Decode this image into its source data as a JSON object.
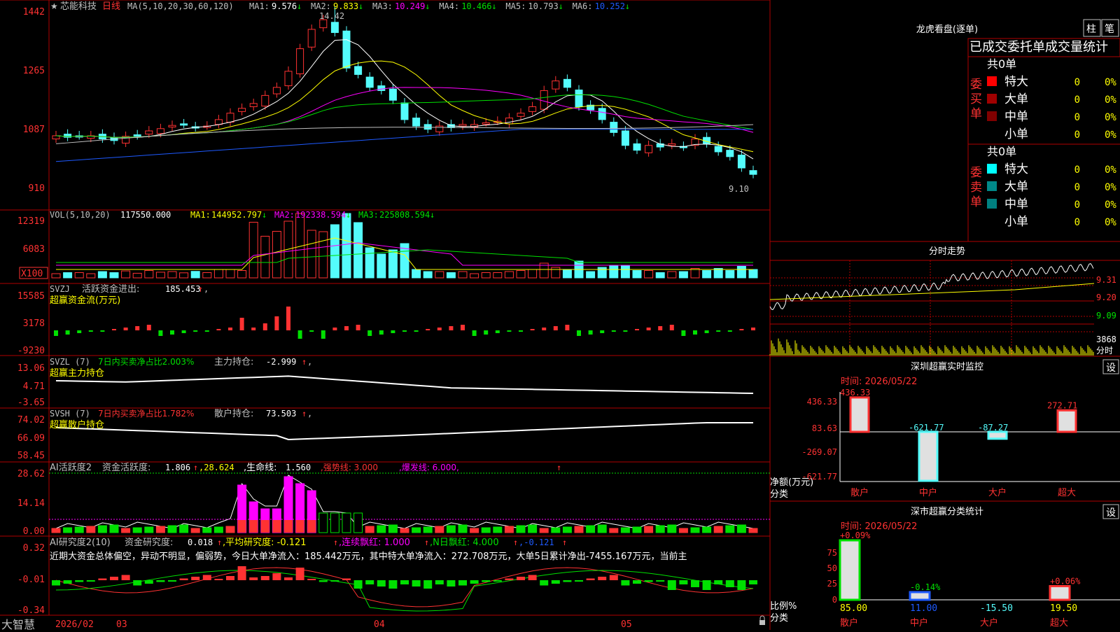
{
  "colors": {
    "up": "#ff3232",
    "down": "#54fcfc",
    "ma1": "#ffffff",
    "ma2": "#ffff00",
    "ma3": "#ff00ff",
    "ma4": "#00e000",
    "ma5": "#c0c0c0",
    "ma6": "#1e5aff",
    "green": "#00e000",
    "grid": "#b00000"
  },
  "brand": "大智慧",
  "stock": {
    "star": "★",
    "name": "芯能科技",
    "period": "日线",
    "ma_params": "MA(5,10,20,30,60,120)",
    "ma": [
      {
        "label": "MA1:",
        "value": "9.576",
        "arrow": "↓"
      },
      {
        "label": "MA2:",
        "value": "9.833",
        "arrow": "↓"
      },
      {
        "label": "MA3:",
        "value": "10.249",
        "arrow": "↓"
      },
      {
        "label": "MA4:",
        "value": "10.466",
        "arrow": "↓"
      },
      {
        "label": "MA5:",
        "value": "10.793",
        "arrow": "↓"
      },
      {
        "label": "MA6:",
        "value": "10.252",
        "arrow": "↓"
      }
    ],
    "high_label": "14.42",
    "low_label": "9.10",
    "y_ticks": [
      "1442",
      "1265",
      "1087",
      "910"
    ]
  },
  "vol": {
    "title": "VOL(5,10,20)",
    "value": "117550.000",
    "ma": [
      {
        "label": "MA1:",
        "value": "144952.797",
        "arrow": "↓"
      },
      {
        "label": "MA2:",
        "value": "192338.594",
        "arrow": "↓"
      },
      {
        "label": "MA3:",
        "value": "225808.594",
        "arrow": "↓"
      }
    ],
    "y_ticks": [
      "12319",
      "6083"
    ],
    "unit": "X100"
  },
  "svzj": {
    "title": "SVZJ",
    "label": "活跃资金进出:",
    "value": "185.453",
    "arrow": "↑",
    "comma": ",",
    "sub": "超赢资金流(万元)",
    "y_ticks": [
      "15585",
      "3178",
      "-9230"
    ]
  },
  "svzl": {
    "title": "SVZL (7)",
    "ratio": "7日内买卖净占比2.003%",
    "label": "主力持仓:",
    "value": "-2.999",
    "arrow": "↑",
    "comma": ",",
    "sub": "超赢主力持仓",
    "y_ticks": [
      "13.06",
      "4.71",
      "-3.65"
    ]
  },
  "svsh": {
    "title": "SVSH (7)",
    "ratio": "7日内买卖净占比1.782%",
    "label": "散户持仓:",
    "value": "73.503",
    "arrow": "↑",
    "comma": ",",
    "sub": "超赢散户持仓",
    "y_ticks": [
      "74.02",
      "66.09",
      "58.45"
    ]
  },
  "ai1": {
    "title": "AI活跃度2",
    "label": "资金活跃度:",
    "value": "1.806",
    "arrow": "↑",
    "v2": ",28.624",
    "life_label": ",生命线:",
    "life_value": "1.560",
    "strong": ",强势线: 3.000",
    "burst": ",爆发线: 6.000,",
    "y_ticks": [
      "28.62",
      "14.14",
      "0.00"
    ],
    "mark": "↑"
  },
  "ai2": {
    "title": "AI研究度2(10)",
    "label": "资金研究度:",
    "value": "0.018",
    "arrow": "↑",
    "avg": ",平均研究度: -0.121",
    "avg_arrow": "↑",
    "red": ",连续飘红: 1.000",
    "red_arrow": "↑",
    "nred": ",N日飘红: 4.000",
    "nred_arrow": "↑",
    "tail": ",-0.121",
    "tail_arrow": "↑",
    "comment": "近期大资金总体偏空，异动不明显，偏弱势，今日大单净流入：185.442万元，其中特大单净流入：272.708万元，大单5日累计净出-7455.167万元，当前主",
    "y_ticks": [
      "0.32",
      "-0.01",
      "-0.34"
    ]
  },
  "x_axis": [
    "2026/02",
    "03",
    "04",
    "05"
  ],
  "right": {
    "lhb_title": "龙虎看盘(逐单)",
    "btn_zhu": "柱",
    "btn_bi": "笔",
    "tabs": [
      "已成交委托单成交量统计"
    ],
    "buy_total": "共0单",
    "buy_label": "委买单",
    "sell_total": "共0单",
    "sell_label": "委卖单",
    "buy_rows": [
      {
        "name": "特大",
        "v": "0",
        "p": "0%"
      },
      {
        "name": "大单",
        "v": "0",
        "p": "0%"
      },
      {
        "name": "中单",
        "v": "0",
        "p": "0%"
      },
      {
        "name": "小单",
        "v": "0",
        "p": "0%"
      }
    ],
    "sell_rows": [
      {
        "name": "特大",
        "v": "0",
        "p": "0%"
      },
      {
        "name": "大单",
        "v": "0",
        "p": "0%"
      },
      {
        "name": "中单",
        "v": "0",
        "p": "0%"
      },
      {
        "name": "小单",
        "v": "0",
        "p": "0%"
      }
    ],
    "fs_title": "分时走势",
    "fs_ticks": [
      "9.31",
      "9.20",
      "9.09"
    ],
    "fs_vol": "3868",
    "fs_unit": "分时",
    "sz_title": "深圳超赢实时监控",
    "sz_btn": "设",
    "sz_time": "时间: 2026/05/22",
    "sz_ticks": [
      "436.33",
      "83.63",
      "-269.07",
      "-621.77"
    ],
    "sz_ylabel": "净额(万元)",
    "sz_xlabel": "分类",
    "sz_vals": [
      "436.33",
      "-621.77",
      "-87.27",
      "272.71"
    ],
    "cats": [
      "散户",
      "中户",
      "大户",
      "超大"
    ],
    "ss_title": "深市超赢分类统计",
    "ss_btn": "设",
    "ss_time": "时间: 2026/05/22",
    "ss_ticks": [
      "75",
      "50",
      "25",
      "0"
    ],
    "ss_ylabel": "比例%",
    "ss_xlabel": "分类",
    "ss_pcts": [
      "+0.09%",
      "-0.14%",
      "",
      "+0.06%"
    ],
    "ss_vals": [
      "85.00",
      "11.00",
      "-15.50",
      "19.50"
    ]
  }
}
